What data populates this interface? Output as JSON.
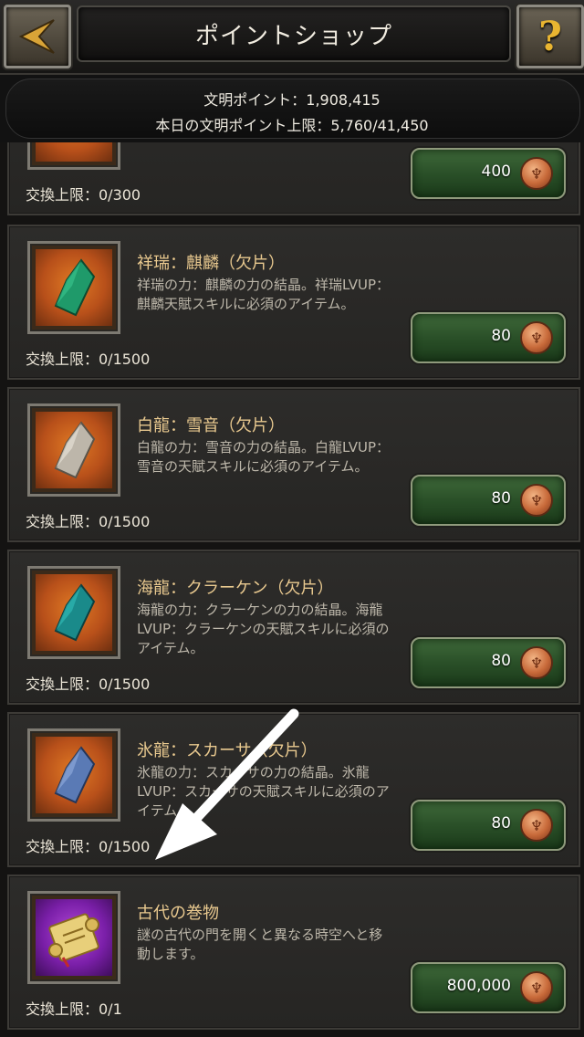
{
  "header": {
    "title": "ポイントショップ",
    "help_label": "?"
  },
  "points": {
    "line1": "文明ポイント：1,908,415",
    "line2": "本日の文明ポイント上限：5,760/41,450"
  },
  "items": [
    {
      "name": "",
      "desc": "",
      "limit": "交換上限：0/300",
      "price": "400",
      "color": "#e07a24"
    },
    {
      "name": "祥瑞：麒麟（欠片）",
      "desc": "祥瑞の力：麒麟の力の結晶。祥瑞LVUP：麒麟天賦スキルに必須のアイテム。",
      "limit": "交換上限：0/1500",
      "price": "80",
      "crystal": "#1f9a6a"
    },
    {
      "name": "白龍：雪音（欠片）",
      "desc": "白龍の力：雪音の力の結晶。白龍LVUP：雪音の天賦スキルに必須のアイテム。",
      "limit": "交換上限：0/1500",
      "price": "80",
      "crystal": "#bdb6aa"
    },
    {
      "name": "海龍：クラーケン（欠片）",
      "desc": "海龍の力：クラーケンの力の結晶。海龍LVUP：クラーケンの天賦スキルに必須のアイテム。",
      "limit": "交換上限：0/1500",
      "price": "80",
      "crystal": "#1a8a8a"
    },
    {
      "name": "氷龍：スカーサ（欠片）",
      "desc": "氷龍の力：スカーサの力の結晶。氷龍LVUP：スカーサの天賦スキルに必須のアイテム。",
      "limit": "交換上限：0/1500",
      "price": "80",
      "crystal": "#5a7ab5"
    },
    {
      "name": "古代の巻物",
      "desc": "謎の古代の門を開くと異なる時空へと移動します。",
      "limit": "交換上限：0/1",
      "price": "800,000",
      "crystal": "scroll"
    }
  ]
}
